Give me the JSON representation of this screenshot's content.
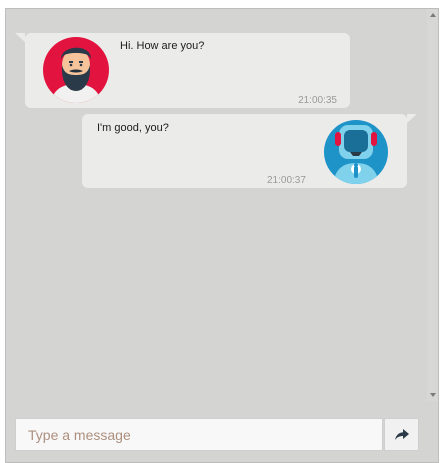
{
  "conversation": {
    "messages": [
      {
        "direction": "incoming",
        "sender_avatar": "bearded-man-avatar",
        "text": "Hi. How are you?",
        "time": "21:00:35"
      },
      {
        "direction": "outgoing",
        "sender_avatar": "robot-avatar",
        "text": "I'm good, you?",
        "time": "21:00:37"
      }
    ]
  },
  "composer": {
    "placeholder": "Type a message",
    "send_icon": "send-arrow-icon"
  },
  "colors": {
    "chat_background": "#d4d4d2",
    "bubble": "#ebebea",
    "man_avatar_circle": "#e2133f",
    "robot_avatar_circle": "#1e93c8",
    "placeholder_text": "#ad8f7e"
  }
}
